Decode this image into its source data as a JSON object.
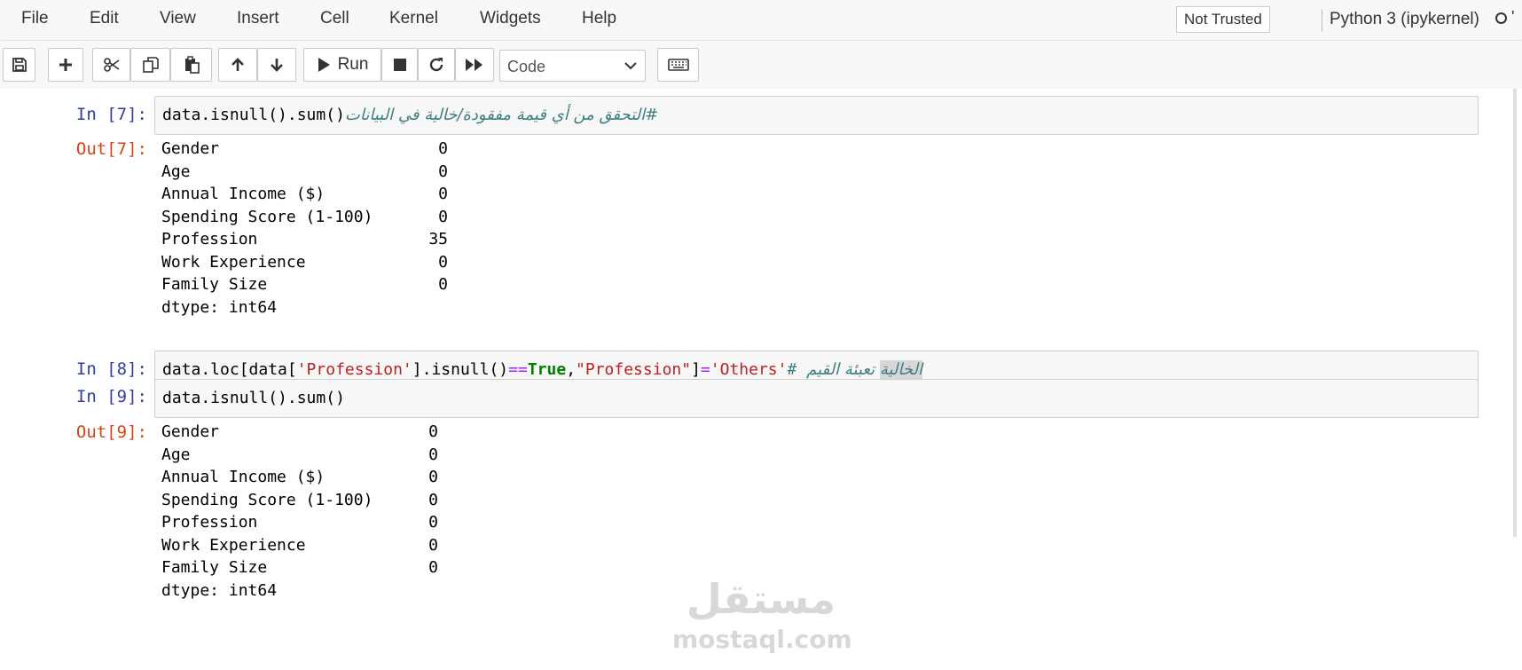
{
  "menu": {
    "items": [
      "File",
      "Edit",
      "View",
      "Insert",
      "Cell",
      "Kernel",
      "Widgets",
      "Help"
    ],
    "trusted_label": "Not Trusted",
    "kernel_name": "Python 3 (ipykernel)"
  },
  "toolbar": {
    "run_label": "Run",
    "cell_type": "Code",
    "icons": [
      "save-icon",
      "plus-icon",
      "cut-icon",
      "copy-icon",
      "paste-icon",
      "arrow-up-icon",
      "arrow-down-icon",
      "play-icon",
      "stop-icon",
      "restart-icon",
      "fast-forward-icon",
      "keyboard-icon"
    ]
  },
  "cells": [
    {
      "in_prompt": "In [7]:",
      "code": "data.isnull().sum()",
      "comment": "#التحقق من أي قيمة مفقودة/خالية في البيانات",
      "out_prompt": "Out[7]:",
      "output": [
        {
          "label": "Gender",
          "value": "0"
        },
        {
          "label": "Age",
          "value": "0"
        },
        {
          "label": "Annual Income ($)",
          "value": "0"
        },
        {
          "label": "Spending Score (1-100)",
          "value": "0"
        },
        {
          "label": "Profession",
          "value": "35"
        },
        {
          "label": "Work Experience",
          "value": "0"
        },
        {
          "label": "Family Size",
          "value": "0"
        }
      ],
      "dtype": "dtype: int64"
    },
    {
      "in_prompt": "In [8]:",
      "code_parts": {
        "p1": "data.loc[data[",
        "s1": "'Profession'",
        "p2": "].isnull()",
        "op": "==",
        "kw": "True",
        "p3": ",",
        "s2": "\"Profession\"",
        "p4": "]",
        "eq": "=",
        "s3": "'Others'",
        "hash": "# ",
        "sel": "الخالية",
        "rest": " تعبئة القيم"
      }
    },
    {
      "in_prompt": "In [9]:",
      "code": "data.isnull().sum()",
      "out_prompt": "Out[9]:",
      "output": [
        {
          "label": "Gender",
          "value": "0"
        },
        {
          "label": "Age",
          "value": "0"
        },
        {
          "label": "Annual Income ($)",
          "value": "0"
        },
        {
          "label": "Spending Score (1-100)",
          "value": "0"
        },
        {
          "label": "Profession",
          "value": "0"
        },
        {
          "label": "Work Experience",
          "value": "0"
        },
        {
          "label": "Family Size",
          "value": "0"
        }
      ],
      "dtype": "dtype: int64"
    }
  ],
  "watermark": {
    "logo": "مستقل",
    "text": "mostaql.com"
  }
}
